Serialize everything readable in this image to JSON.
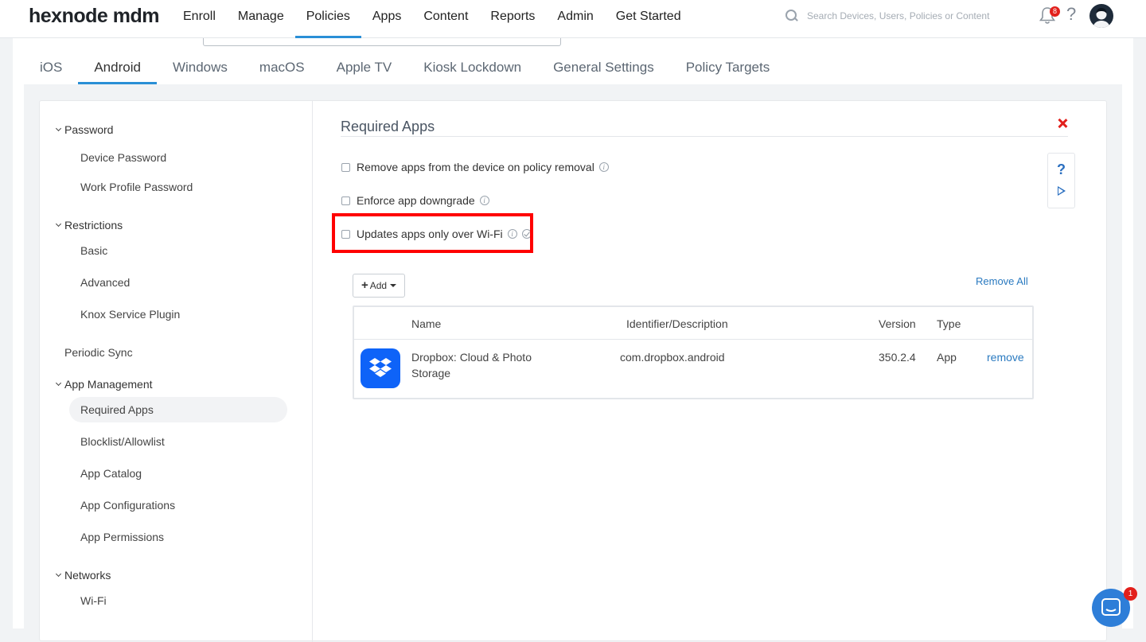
{
  "brand": {
    "logo": "hexnode mdm"
  },
  "nav": {
    "items": [
      "Enroll",
      "Manage",
      "Policies",
      "Apps",
      "Content",
      "Reports",
      "Admin",
      "Get Started"
    ],
    "active": "Policies"
  },
  "search": {
    "placeholder": "Search Devices, Users, Policies or Content"
  },
  "notifications": {
    "count": "8"
  },
  "platform_tabs": {
    "items": [
      "iOS",
      "Android",
      "Windows",
      "macOS",
      "Apple TV",
      "Kiosk Lockdown",
      "General Settings",
      "Policy Targets"
    ],
    "active": "Android"
  },
  "sidebar": {
    "groups": {
      "password": "Password",
      "restrictions": "Restrictions",
      "app_management": "App Management",
      "networks": "Networks"
    },
    "items": {
      "device_password": "Device Password",
      "work_profile_password": "Work Profile Password",
      "basic": "Basic",
      "advanced": "Advanced",
      "knox": "Knox Service Plugin",
      "periodic_sync": "Periodic Sync",
      "required_apps": "Required Apps",
      "blocklist": "Blocklist/Allowlist",
      "app_catalog": "App Catalog",
      "app_configurations": "App Configurations",
      "app_permissions": "App Permissions",
      "wifi": "Wi-Fi"
    },
    "active": "Required Apps"
  },
  "panel": {
    "title": "Required Apps",
    "options": {
      "remove_on_removal": "Remove apps from the device on policy removal",
      "enforce_downgrade": "Enforce app downgrade",
      "wifi_only": "Updates apps only over Wi-Fi"
    },
    "add_label": "Add",
    "remove_all": "Remove All",
    "table": {
      "headers": {
        "name": "Name",
        "identifier": "Identifier/Description",
        "version": "Version",
        "type": "Type"
      },
      "rows": [
        {
          "name_line1": "Dropbox: Cloud & Photo",
          "name_line2": "Storage",
          "identifier": "com.dropbox.android",
          "version": "350.2.4",
          "type": "App",
          "action": "remove",
          "icon": "dropbox-icon"
        }
      ]
    }
  },
  "chat": {
    "unread": "1"
  },
  "colors": {
    "accent": "#2a8fd6",
    "link": "#2a7ac0",
    "danger": "#e2201c",
    "dropbox": "#0e63f8",
    "highlight": "#ff0000"
  }
}
